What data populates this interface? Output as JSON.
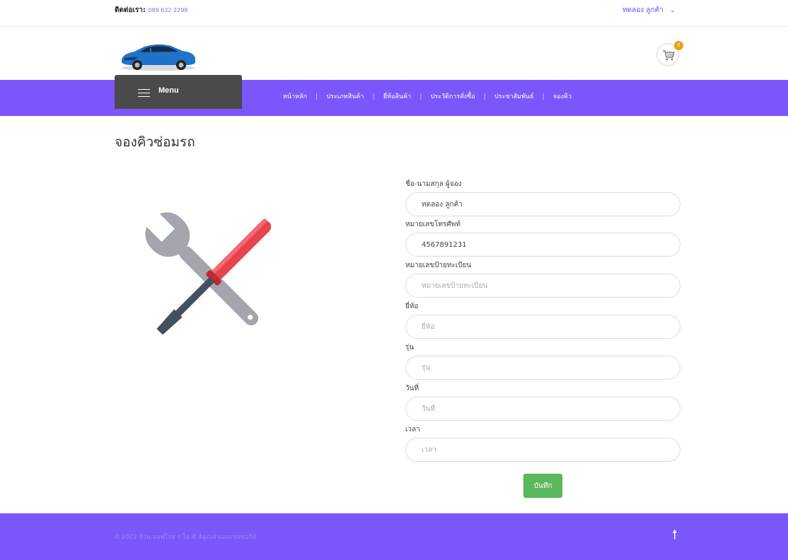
{
  "topbar": {
    "contact_label": "ติดต่อเรา:",
    "contact_phone": "089 632 2299",
    "user_name": "ทดลอง ลูกค้า",
    "user_menu_icon": "chevron-down-icon"
  },
  "header": {
    "logo_icon": "car-icon",
    "cart_icon": "shopping-cart-icon",
    "cart_count": "0"
  },
  "nav": {
    "menu_label": "Menu",
    "items": [
      {
        "label": "หน้าหลัก"
      },
      {
        "label": "ประเภทสินค้า"
      },
      {
        "label": "ยี่ห้อสินค้า"
      },
      {
        "label": "ประวัติการสั่งซื้อ"
      },
      {
        "label": "ประชาสัมพันธ์"
      },
      {
        "label": "จองคิว"
      }
    ],
    "separator": "|"
  },
  "page": {
    "title": "จองคิวซ่อมรถ",
    "illustration_icon": "tools-icon"
  },
  "form": {
    "fields": [
      {
        "label": "ชื่อ-นามสกุล ผู้จอง",
        "value": "ทดลอง ลูกค้า",
        "placeholder": ""
      },
      {
        "label": "หมายเลขโทรศัพท์",
        "value": "4567891231",
        "placeholder": ""
      },
      {
        "label": "หมายเลขป้ายทะเบียน",
        "value": "",
        "placeholder": "หมายเลขป้ายทะเบียน"
      },
      {
        "label": "ยี่ห้อ",
        "value": "",
        "placeholder": "ยี่ห้อ"
      },
      {
        "label": "รุ่น",
        "value": "",
        "placeholder": "รุ่น"
      },
      {
        "label": "วันที่",
        "value": "",
        "placeholder": "วันที่"
      },
      {
        "label": "เวลา",
        "value": "",
        "placeholder": "เวลา"
      }
    ],
    "save_label": "บันทึก"
  },
  "footer": {
    "copyright": "©2022 ร้าน ออฟไรส ร.ไอ.พี 4คูณ4 แอคเซสซอรีส์",
    "scroll_top_icon": "arrow-up-icon",
    "scroll_top_glyph": "🠕"
  },
  "colors": {
    "brand": "#7b57fb",
    "menu_button": "#4a4a4a",
    "save_button": "#5cb85c",
    "cart_badge": "#f39c12"
  }
}
